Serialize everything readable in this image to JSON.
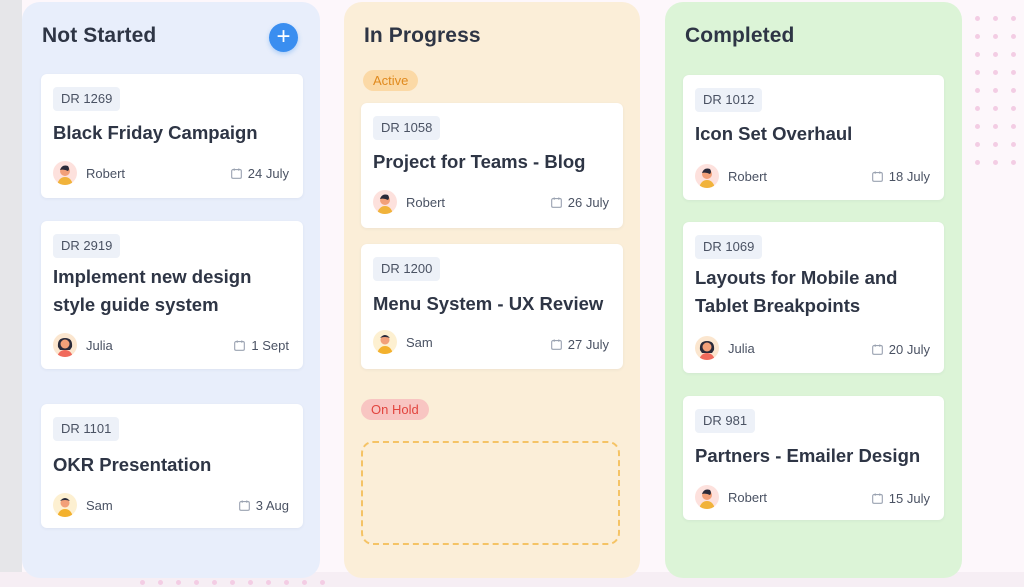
{
  "columns": {
    "not_started": {
      "title": "Not Started",
      "add_symbol": "+",
      "cards": [
        {
          "id": "DR 1269",
          "title": "Black Friday Campaign",
          "assignee": "Robert",
          "date": "24 July"
        },
        {
          "id": "DR 2919",
          "title_line1": "Implement new design",
          "title_line2": "style guide system",
          "assignee": "Julia",
          "date": "1 Sept"
        },
        {
          "id": "DR 1101",
          "title": "OKR Presentation",
          "assignee": "Sam",
          "date": "3 Aug"
        }
      ]
    },
    "in_progress": {
      "title": "In Progress",
      "active_label": "Active",
      "on_hold_label": "On Hold",
      "cards": [
        {
          "id": "DR 1058",
          "title": "Project for Teams - Blog",
          "assignee": "Robert",
          "date": "26 July"
        },
        {
          "id": "DR 1200",
          "title": "Menu System - UX Review",
          "assignee": "Sam",
          "date": "27 July"
        }
      ]
    },
    "completed": {
      "title": "Completed",
      "cards": [
        {
          "id": "DR 1012",
          "title": "Icon Set Overhaul",
          "assignee": "Robert",
          "date": "18 July"
        },
        {
          "id": "DR 1069",
          "title_line1": "Layouts for Mobile and",
          "title_line2": "Tablet Breakpoints",
          "assignee": "Julia",
          "date": "20 July"
        },
        {
          "id": "DR 981",
          "title": "Partners - Emailer Design",
          "assignee": "Robert",
          "date": "15 July"
        }
      ]
    }
  },
  "colors": {
    "accent": "#3a8ef0",
    "not_started_bg": "#e8eefb",
    "in_progress_bg": "#fbeed8",
    "completed_bg": "#dcf4d7",
    "active_text": "#e08a1e",
    "on_hold_text": "#e2453f"
  },
  "icons": {
    "add": "plus-icon",
    "date": "calendar-icon",
    "avatar": "avatar-icon"
  }
}
